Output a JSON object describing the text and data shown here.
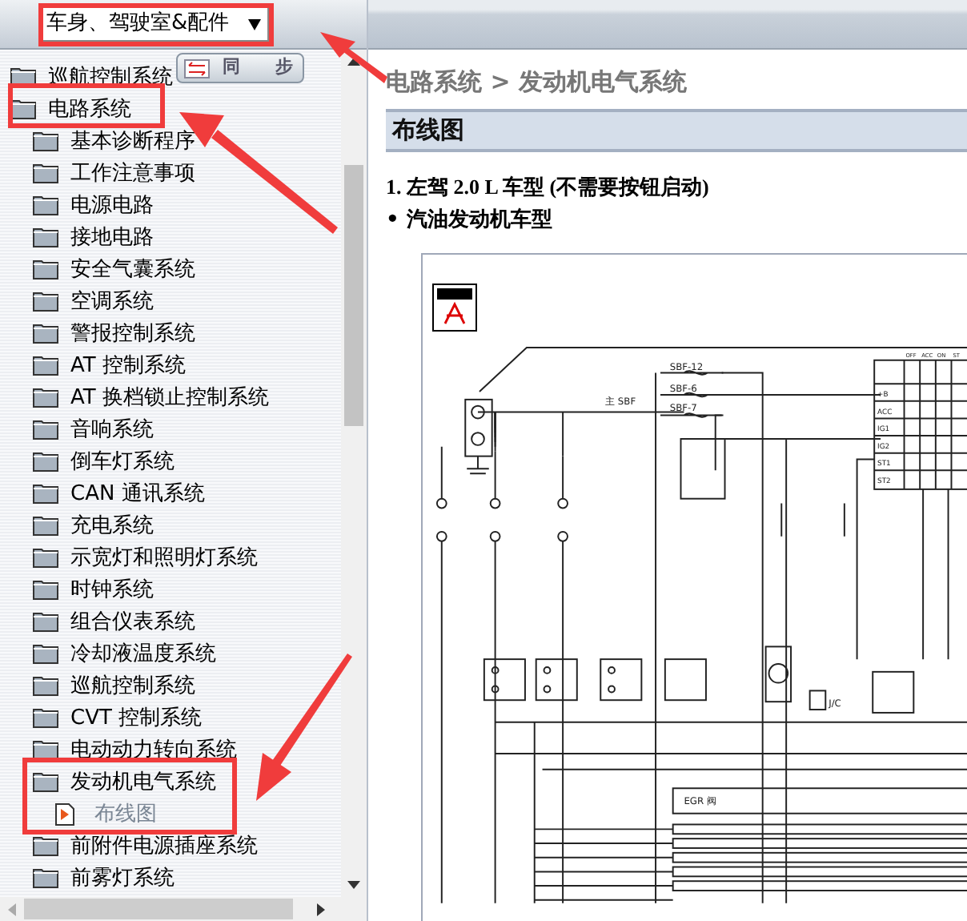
{
  "sidebar": {
    "dropdown": {
      "value": "车身、驾驶室&配件"
    },
    "sync_button": {
      "label": "同　　步"
    },
    "tree": [
      {
        "label": "巡航控制系统",
        "kind": "folder",
        "selected": false
      },
      {
        "label": "电路系统",
        "kind": "folder",
        "selected": false,
        "children": [
          {
            "label": "基本诊断程序",
            "kind": "folder",
            "selected": false
          },
          {
            "label": "工作注意事项",
            "kind": "folder",
            "selected": false
          },
          {
            "label": "电源电路",
            "kind": "folder",
            "selected": false
          },
          {
            "label": "接地电路",
            "kind": "folder",
            "selected": false
          },
          {
            "label": "安全气囊系统",
            "kind": "folder",
            "selected": false
          },
          {
            "label": "空调系统",
            "kind": "folder",
            "selected": false
          },
          {
            "label": "警报控制系统",
            "kind": "folder",
            "selected": false
          },
          {
            "label": "AT 控制系统",
            "kind": "folder",
            "selected": false
          },
          {
            "label": "AT 换档锁止控制系统",
            "kind": "folder",
            "selected": false
          },
          {
            "label": "音响系统",
            "kind": "folder",
            "selected": false
          },
          {
            "label": "倒车灯系统",
            "kind": "folder",
            "selected": false
          },
          {
            "label": "CAN 通讯系统",
            "kind": "folder",
            "selected": false
          },
          {
            "label": "充电系统",
            "kind": "folder",
            "selected": false
          },
          {
            "label": "示宽灯和照明灯系统",
            "kind": "folder",
            "selected": false
          },
          {
            "label": "时钟系统",
            "kind": "folder",
            "selected": false
          },
          {
            "label": "组合仪表系统",
            "kind": "folder",
            "selected": false
          },
          {
            "label": "冷却液温度系统",
            "kind": "folder",
            "selected": false
          },
          {
            "label": "巡航控制系统",
            "kind": "folder",
            "selected": false
          },
          {
            "label": "CVT 控制系统",
            "kind": "folder",
            "selected": false
          },
          {
            "label": "电动动力转向系统",
            "kind": "folder",
            "selected": false
          },
          {
            "label": "发动机电气系统",
            "kind": "folder",
            "selected": false,
            "children": [
              {
                "label": "布线图",
                "kind": "page",
                "selected": true
              }
            ]
          },
          {
            "label": "前附件电源插座系统",
            "kind": "folder",
            "selected": false
          },
          {
            "label": "前雾灯系统",
            "kind": "folder",
            "selected": false
          }
        ]
      }
    ]
  },
  "content": {
    "breadcrumb": "电路系统 > 发动机电气系统",
    "heading": "布线图",
    "subheading": "1. 左驾 2.0 L 车型 (不需要按钮启动)",
    "bullet": "• 汽油发动机车型",
    "diagram": {
      "labels": [
        "SBF-12",
        "SBF-6",
        "SBF-7",
        "主 SBF",
        "J/C",
        "EGR 阀"
      ],
      "switch_columns": [
        "OFF",
        "ACC",
        "ON",
        "ST"
      ],
      "switch_rows": [
        "+B",
        "ACC",
        "IG1",
        "IG2",
        "ST1",
        "ST2"
      ]
    }
  }
}
